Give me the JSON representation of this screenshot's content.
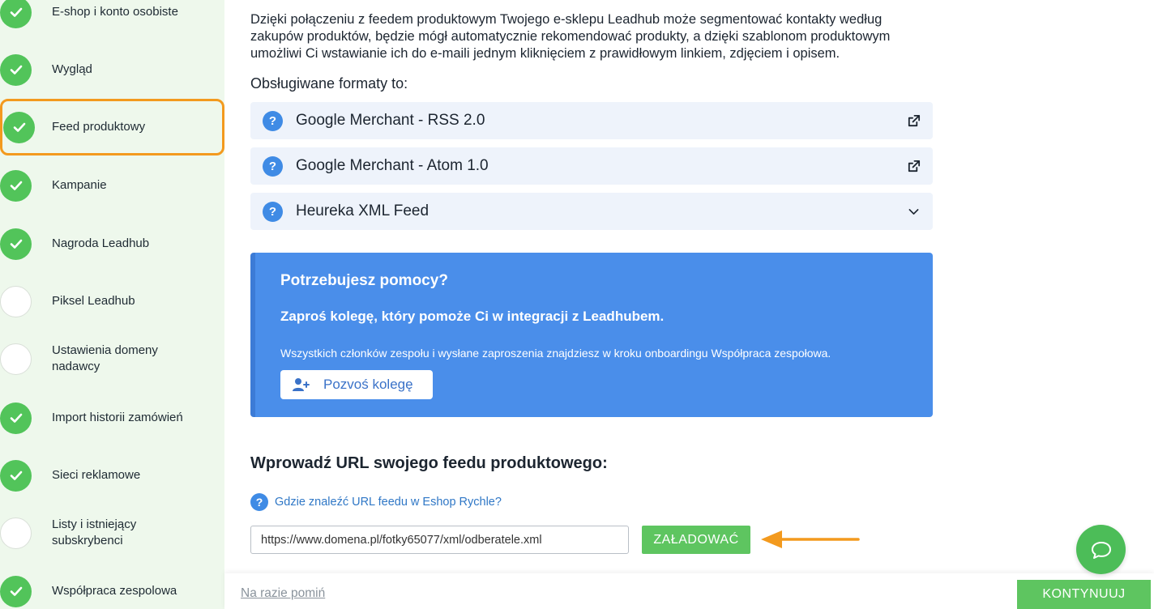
{
  "sidebar": {
    "items": [
      {
        "label": "E-shop i konto osobiste",
        "done": true
      },
      {
        "label": "Wygląd",
        "done": true
      },
      {
        "label": "Feed produktowy",
        "done": true,
        "active": true
      },
      {
        "label": "Kampanie",
        "done": true
      },
      {
        "label": "Nagroda Leadhub",
        "done": true
      },
      {
        "label": "Piksel Leadhub",
        "done": false
      },
      {
        "label": "Ustawienia domeny nadawcy",
        "done": false
      },
      {
        "label": "Import historii zamówień",
        "done": true
      },
      {
        "label": "Sieci reklamowe",
        "done": true
      },
      {
        "label": "Listy i istniejący subskrybenci",
        "done": false
      },
      {
        "label": "Współpraca zespolowa",
        "done": true
      }
    ]
  },
  "main": {
    "intro": "Dzięki połączeniu z feedem produktowym Twojego e-sklepu Leadhub może segmentować kontakty według zakupów produktów, będzie mógł automatycznie rekomendować produkty, a dzięki szablonom produktowym umożliwi Ci wstawianie ich do e-maili jednym kliknięciem z prawidłowym linkiem, zdjęciem i opisem.",
    "formats_title": "Obsługiwane formaty to:",
    "formats": [
      {
        "label": "Google Merchant - RSS 2.0",
        "icon": "external-link-icon"
      },
      {
        "label": "Google Merchant - Atom 1.0",
        "icon": "external-link-icon"
      },
      {
        "label": "Heureka XML Feed",
        "icon": "chevron-down-icon"
      }
    ],
    "help": {
      "title": "Potrzebujesz pomocy?",
      "subtitle": "Zaproś kolegę, który pomoże Ci w integracji z Leadhubem.",
      "note": "Wszystkich członków zespołu i wysłane zaproszenia znajdziesz w kroku onboardingu Współpraca zespołowa.",
      "invite_label": "Pozvoś kolegę"
    },
    "url_title": "Wprowadź URL swojego feedu produktowego:",
    "where_link": "Gdzie znaleźć URL feedu w Eshop Rychle?",
    "url_value": "https://www.domena.pl/fotky65077/xml/odberatele.xml",
    "load_label": "ZAŁADOWAĆ"
  },
  "footer": {
    "skip_label": "Na razie pomiń",
    "continue_label": "KONTYNUUJ"
  },
  "colors": {
    "accent_green": "#5ec560",
    "accent_blue": "#4a8eea",
    "highlight_orange": "#f39a1e"
  }
}
